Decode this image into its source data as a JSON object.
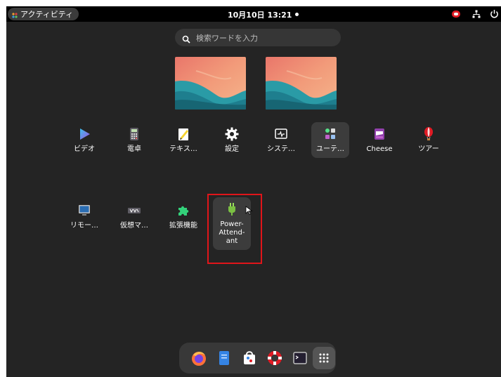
{
  "topbar": {
    "activities_label": "アクティビティ",
    "clock": "10月10日 13:21"
  },
  "search": {
    "placeholder": "検索ワードを入力",
    "value": ""
  },
  "workspaces": [
    "workspace-1",
    "workspace-2"
  ],
  "apps": [
    {
      "label": "ビデオ",
      "icon": "video-icon"
    },
    {
      "label": "電卓",
      "icon": "calculator-icon"
    },
    {
      "label": "テキス…",
      "icon": "text-editor-icon"
    },
    {
      "label": "設定",
      "icon": "settings-gear-icon"
    },
    {
      "label": "システ…",
      "icon": "system-monitor-icon"
    },
    {
      "label": "ユーテ…",
      "icon": "utilities-folder-icon"
    },
    {
      "label": "Cheese",
      "icon": "cheese-icon"
    },
    {
      "label": "ツアー",
      "icon": "tour-balloon-icon"
    },
    {
      "label": "リモー…",
      "icon": "remote-desktop-icon"
    },
    {
      "label": "仮想マ…",
      "icon": "virtual-machine-icon"
    },
    {
      "label": "拡張機能",
      "icon": "extensions-puzzle-icon"
    },
    {
      "label": "Power-\nAttend-\nant",
      "icon": "power-plug-icon"
    }
  ],
  "dock": [
    "firefox-icon",
    "files-icon",
    "software-icon",
    "help-icon",
    "terminal-icon",
    "app-grid-icon"
  ],
  "colors": {
    "background": "#242424",
    "topbar": "#000000",
    "highlight_box": "#e0151a"
  }
}
